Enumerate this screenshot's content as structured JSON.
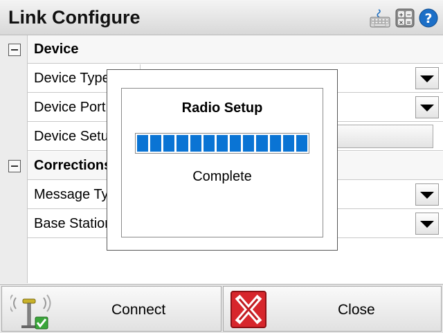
{
  "window": {
    "title": "Link Configure"
  },
  "titlebar_icons": [
    "keyboard-icon",
    "calculator-icon",
    "help-icon"
  ],
  "groups": [
    {
      "label": "Device",
      "rows": [
        {
          "label": "Device Type",
          "control": "dropdown"
        },
        {
          "label": "Device Port",
          "control": "dropdown"
        },
        {
          "label": "Device Setup",
          "control": "button"
        }
      ]
    },
    {
      "label": "Corrections",
      "rows": [
        {
          "label": "Message Type",
          "control": "dropdown"
        },
        {
          "label": "Base Station",
          "control": "dropdown"
        }
      ]
    }
  ],
  "dialog": {
    "title": "Radio Setup",
    "status": "Complete",
    "progress_fraction": 1.0
  },
  "bottom": {
    "connect_label": "Connect",
    "close_label": "Close"
  },
  "colors": {
    "progress": "#0a74d4",
    "close_icon": "#d7262c",
    "help_icon": "#1c6fc7"
  }
}
